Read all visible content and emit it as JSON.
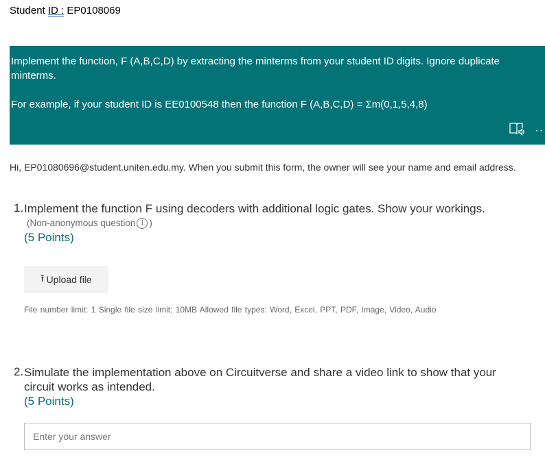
{
  "header": {
    "student_label": "Student",
    "id_word": "ID :",
    "student_id": "EP0108069"
  },
  "banner": {
    "instruction": "Implement the function, F (A,B,C,D) by extracting the minterms from your student ID digits. Ignore duplicate minterms.",
    "example": "For example, if your student ID is EE0100548 then the function F (A,B,C,D) = Σm(0,1,5,4,8)",
    "icons": [
      "immersive-reader-icon",
      "more-options-icon"
    ],
    "color": "#047377"
  },
  "account_notice": "Hi, EP01080696@student.uniten.edu.my. When you submit this form, the owner will see your name and email address.",
  "questions": [
    {
      "number": "1.",
      "text": "Implement the function F using decoders with additional logic gates. Show your workings.",
      "note": "(Non-anonymous question",
      "note_close": ")",
      "points": "(5 Points)",
      "upload_label": "Upload file",
      "file_limits": "File number limit: 1   Single file size limit: 10MB   Allowed file types: Word, Excel, PPT, PDF, Image, Video, Audio"
    },
    {
      "number": "2.",
      "text_line1": "Simulate the implementation above on Circuitverse and share a video link to show that your",
      "text_line2": "circuit works as intended.",
      "points": "(5 Points)",
      "placeholder": "Enter your answer"
    }
  ]
}
